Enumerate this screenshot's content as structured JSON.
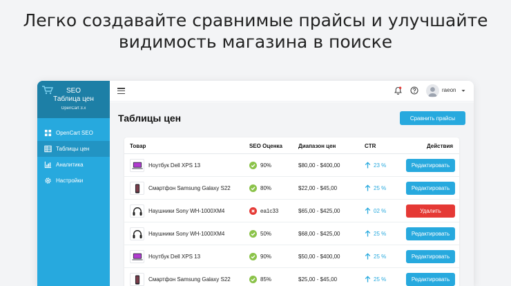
{
  "hero": {
    "line1": "Легко создавайте сравнимые прайсы и улучшайте",
    "line2": "видимость магазина в поиске"
  },
  "brand": {
    "title1": "SEO",
    "title2": "Таблица цен",
    "subtitle": "OpenCart 3.x"
  },
  "sidebar": {
    "items": [
      {
        "label": "OpenCart SEO",
        "icon": "dashboard-icon"
      },
      {
        "label": "Таблицы цен",
        "icon": "table-icon",
        "active": true
      },
      {
        "label": "Аналитика",
        "icon": "chart-icon"
      },
      {
        "label": "Настройки",
        "icon": "gear-icon"
      }
    ]
  },
  "topbar": {
    "username": "raeon"
  },
  "page": {
    "title": "Таблицы цен",
    "compare_button": "Сравнить прайсы"
  },
  "table": {
    "headers": {
      "product": "Товар",
      "score": "SEO Оценка",
      "range": "Диапазон цен",
      "ctr": "CTR",
      "actions": "Действия"
    },
    "rows": [
      {
        "name": "Ноутбук Dell XPS 13",
        "thumb": "laptop",
        "score": "90%",
        "score_status": "ok",
        "range": "$80,00 - $400,00",
        "ctr": "23 %",
        "action": "Редактировать",
        "action_type": "edit"
      },
      {
        "name": "Смартфон Samsung Galaxy S22",
        "thumb": "phone",
        "score": "80%",
        "score_status": "ok",
        "range": "$22,00 - $45,00",
        "ctr": "25 %",
        "action": "Редактировать",
        "action_type": "edit"
      },
      {
        "name": "Наушники Sony WH-1000XM4",
        "thumb": "headphones",
        "score": "ea1c33",
        "score_status": "error",
        "range": "$65,00 - $425,00",
        "ctr": "02 %",
        "action": "Удалить",
        "action_type": "delete"
      },
      {
        "name": "Наушники Sony WH-1000XM4",
        "thumb": "headphones",
        "score": "50%",
        "score_status": "ok",
        "range": "$68,00 - $425,00",
        "ctr": "25 %",
        "action": "Редактировать",
        "action_type": "edit"
      },
      {
        "name": "Ноутбук Dell XPS 13",
        "thumb": "laptop",
        "score": "90%",
        "score_status": "ok",
        "range": "$50,00 - $400,00",
        "ctr": "25 %",
        "action": "Редактировать",
        "action_type": "edit"
      },
      {
        "name": "Смартфон Samsung Galaxy S22",
        "thumb": "phone",
        "score": "85%",
        "score_status": "ok",
        "range": "$25,00 - $45,00",
        "ctr": "25 %",
        "action": "Редактировать",
        "action_type": "edit"
      }
    ]
  },
  "colors": {
    "accent": "#27a9de",
    "brand_dark": "#1d7fa6",
    "ok": "#8bc34a",
    "error": "#e53935"
  }
}
